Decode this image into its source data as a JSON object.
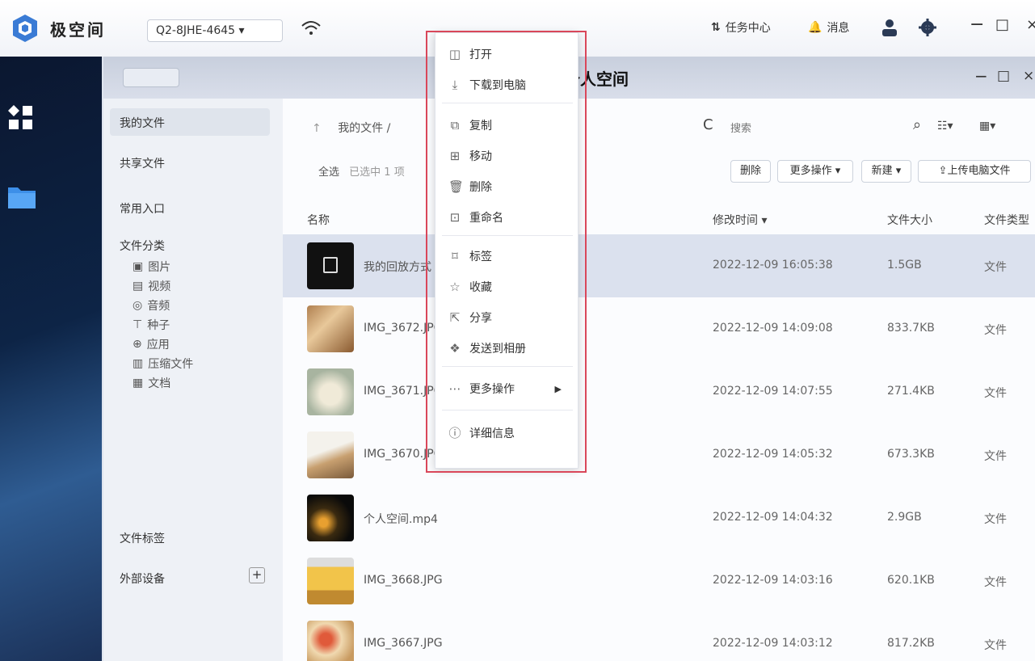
{
  "topbar": {
    "brand": "极空间",
    "device_id": "Q2-8JHE-4645",
    "task_center": "任务中心",
    "messages": "消息"
  },
  "window": {
    "title": "个人空间",
    "back_label": "‹ ›"
  },
  "sidebar": {
    "items": [
      {
        "label": "我的文件"
      },
      {
        "label": "共享文件"
      },
      {
        "label": "常用入口"
      },
      {
        "label": "文件分类"
      },
      {
        "label": "文件标签"
      },
      {
        "label": "外部设备"
      }
    ],
    "categories": [
      {
        "label": "图片",
        "icon": "image-icon"
      },
      {
        "label": "视频",
        "icon": "video-icon"
      },
      {
        "label": "音频",
        "icon": "audio-icon"
      },
      {
        "label": "种子",
        "icon": "seed-icon"
      },
      {
        "label": "应用",
        "icon": "app-icon"
      },
      {
        "label": "压缩文件",
        "icon": "zip-icon"
      },
      {
        "label": "文档",
        "icon": "doc-icon"
      }
    ]
  },
  "main": {
    "path": "我的文件 /",
    "select_all": "全选",
    "selection_info": "已选中 1 项",
    "search_placeholder": "搜索",
    "buttons": {
      "delete": "删除",
      "more_ops": "更多操作",
      "new": "新建",
      "upload": "上传电脑文件"
    },
    "columns": {
      "name": "名称",
      "modified": "修改时间",
      "size": "文件大小",
      "type": "文件类型"
    },
    "files": [
      {
        "name": "我的回放方式",
        "date": "2022-12-09 16:05:38",
        "size": "1.5GB",
        "type": "文件"
      },
      {
        "name": "IMG_3672.JPG",
        "date": "2022-12-09 14:09:08",
        "size": "833.7KB",
        "type": "文件"
      },
      {
        "name": "IMG_3671.JPG",
        "date": "2022-12-09 14:07:55",
        "size": "271.4KB",
        "type": "文件"
      },
      {
        "name": "IMG_3670.JPG",
        "date": "2022-12-09 14:05:32",
        "size": "673.3KB",
        "type": "文件"
      },
      {
        "name": "个人空间.mp4",
        "date": "2022-12-09 14:04:32",
        "size": "2.9GB",
        "type": "文件"
      },
      {
        "name": "IMG_3668.JPG",
        "date": "2022-12-09 14:03:16",
        "size": "620.1KB",
        "type": "文件"
      },
      {
        "name": "IMG_3667.JPG",
        "date": "2022-12-09 14:03:12",
        "size": "817.2KB",
        "type": "文件"
      }
    ]
  },
  "context_menu": {
    "items": [
      {
        "label": "打开",
        "icon": "open-icon"
      },
      {
        "label": "下载到电脑",
        "icon": "download-icon"
      },
      {
        "label": "复制",
        "icon": "copy-icon"
      },
      {
        "label": "移动",
        "icon": "move-icon"
      },
      {
        "label": "删除",
        "icon": "delete-icon"
      },
      {
        "label": "重命名",
        "icon": "rename-icon"
      },
      {
        "label": "标签",
        "icon": "tag-icon"
      },
      {
        "label": "收藏",
        "icon": "star-icon"
      },
      {
        "label": "分享",
        "icon": "share-icon"
      },
      {
        "label": "发送到相册",
        "icon": "album-icon"
      },
      {
        "label": "更多操作",
        "icon": "more-icon"
      },
      {
        "label": "详细信息",
        "icon": "info-icon"
      }
    ]
  }
}
